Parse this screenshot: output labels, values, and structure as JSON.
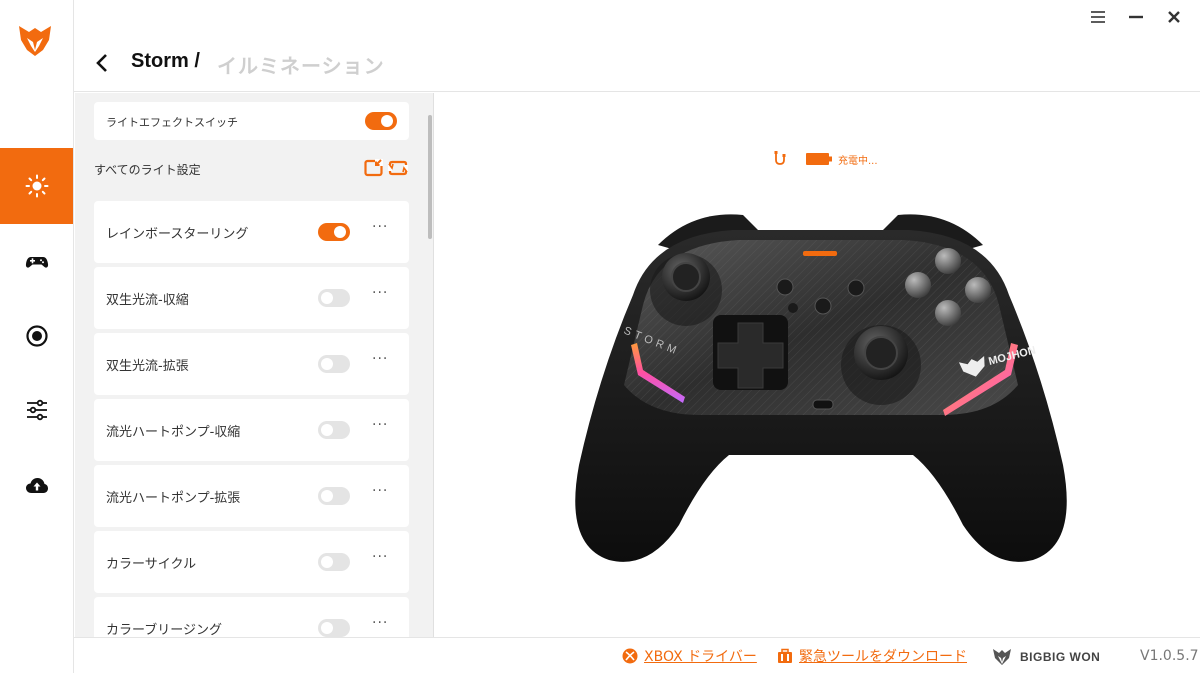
{
  "header": {
    "crumb_parent": "Storm /",
    "crumb_current": "イルミネーション"
  },
  "sidebar": {
    "items": [
      {
        "icon": "sun-icon",
        "active": true
      },
      {
        "icon": "gamepad-icon",
        "active": false
      },
      {
        "icon": "record-icon",
        "active": false
      },
      {
        "icon": "sliders-icon",
        "active": false
      },
      {
        "icon": "cloud-upload-icon",
        "active": false
      }
    ]
  },
  "panel": {
    "light_switch_label": "ライトエフェクトスイッチ",
    "light_switch_on": true,
    "all_light_settings_label": "すべてのライト設定",
    "effects": [
      {
        "label": "レインボースターリング",
        "on": true,
        "more": "···"
      },
      {
        "label": "双生光流-収縮",
        "on": false,
        "more": "···"
      },
      {
        "label": "双生光流-拡張",
        "on": false,
        "more": "···"
      },
      {
        "label": "流光ハートポンプ-収縮",
        "on": false,
        "more": "···"
      },
      {
        "label": "流光ハートポンプ-拡張",
        "on": false,
        "more": "···"
      },
      {
        "label": "カラーサイクル",
        "on": false,
        "more": "···"
      },
      {
        "label": "カラーブリージング",
        "on": false,
        "more": "···"
      }
    ]
  },
  "status": {
    "text": "充電中..."
  },
  "controller": {
    "brand_label": "MOJHON",
    "side_label": "STORM"
  },
  "footer": {
    "xbox_link": "XBOX ドライバー",
    "emergency_link": "緊急ツールをダウンロード",
    "brand": "BIGBIG WON",
    "version": "V1.0.5.7"
  },
  "colors": {
    "accent": "#f26b0f"
  }
}
